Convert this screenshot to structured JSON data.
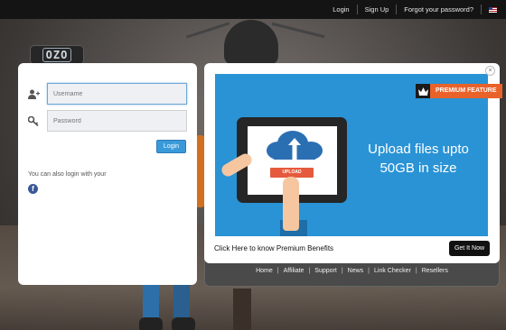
{
  "topnav": {
    "login": "Login",
    "signup": "Sign Up",
    "forgot": "Forgot your password?",
    "flag": "us-flag-icon"
  },
  "logo": {
    "text": "OZO"
  },
  "login_form": {
    "username_placeholder": "Username",
    "password_placeholder": "Password",
    "login_button": "Login",
    "also_login": "You can also login with your",
    "facebook_glyph": "f"
  },
  "popup": {
    "close_glyph": "×",
    "premium_label": "PREMIUM FEATURE",
    "banner_line1": "Upload files upto",
    "banner_line2": "50GB in size",
    "upload_label": "UPLOAD",
    "benefits_text": "Click Here to know Premium Benefits",
    "get_it_now": "Get It Now"
  },
  "footer": {
    "links": [
      "Home",
      "Affiliate",
      "Support",
      "News",
      "Link Checker",
      "Resellers"
    ]
  },
  "colors": {
    "accent": "#3a9ad9",
    "banner": "#2a93d5",
    "premium": "#e8622a",
    "topbar": "#141414"
  }
}
